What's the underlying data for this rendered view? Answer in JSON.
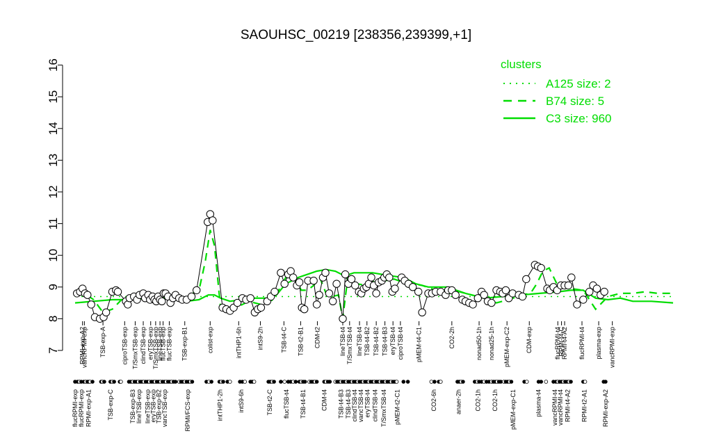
{
  "chart_data": {
    "type": "line",
    "title": "SAOUHSC_00219 [238356,239399,+1]",
    "xlabel": "",
    "ylabel": "",
    "ylim": [
      7,
      16
    ],
    "yticks": [
      7,
      8,
      9,
      10,
      11,
      12,
      13,
      14,
      15,
      16
    ],
    "x_range": [
      0,
      965
    ],
    "top_labels": [
      {
        "x": 12,
        "label": "RPMI-exp-A2"
      },
      {
        "x": 15,
        "label": "vancRPMI-exp"
      },
      {
        "x": 45,
        "label": "TSB-exp-A"
      },
      {
        "x": 80,
        "label": "ciproTSB-exp"
      },
      {
        "x": 97,
        "label": "T/SmxTSB-exp"
      },
      {
        "x": 110,
        "label": "clindTSB-exp"
      },
      {
        "x": 122,
        "label": "eryTSB-exp"
      },
      {
        "x": 130,
        "label": "T/SmxTSB-exp"
      },
      {
        "x": 137,
        "label": "lineTSB-exp"
      },
      {
        "x": 142,
        "label": "flucTSB-exp"
      },
      {
        "x": 152,
        "label": "flucTSB-exp"
      },
      {
        "x": 177,
        "label": "TSB-exp-B1"
      },
      {
        "x": 218,
        "label": "colist-exp"
      },
      {
        "x": 264,
        "label": "intTHP1-6h"
      },
      {
        "x": 299,
        "label": "intS9-2h"
      },
      {
        "x": 337,
        "label": "TSB-t4-C"
      },
      {
        "x": 364,
        "label": "TSB-t2-B1"
      },
      {
        "x": 391,
        "label": "CDM-t2"
      },
      {
        "x": 432,
        "label": "lineTSB-t4"
      },
      {
        "x": 443,
        "label": "T/SmxTSB-t4"
      },
      {
        "x": 459,
        "label": "lineTSB-t4"
      },
      {
        "x": 471,
        "label": "TSB-t4-B2"
      },
      {
        "x": 486,
        "label": "TSB-t4-B2"
      },
      {
        "x": 500,
        "label": "TSB-t4-B3"
      },
      {
        "x": 513,
        "label": "eryTSB-t4"
      },
      {
        "x": 525,
        "label": "ciproTSB-t4"
      },
      {
        "x": 555,
        "label": "pMEM-t4-C1"
      },
      {
        "x": 608,
        "label": "CO2-2h"
      },
      {
        "x": 652,
        "label": "nonad50-1h"
      },
      {
        "x": 672,
        "label": "nonad25-1h"
      },
      {
        "x": 697,
        "label": "pMEM-exp-C2"
      },
      {
        "x": 733,
        "label": "CDM-exp"
      },
      {
        "x": 779,
        "label": "flucRPMI-t4"
      },
      {
        "x": 785,
        "label": "RPMI-t4-C"
      },
      {
        "x": 790,
        "label": "RPMI-t4-A2"
      },
      {
        "x": 818,
        "label": "flucRPMI-t4"
      },
      {
        "x": 845,
        "label": "plasma-exp"
      },
      {
        "x": 867,
        "label": "vancRPMI-exp"
      }
    ],
    "bottom_labels": [
      {
        "x": 0,
        "label": "flucRPMI-exp"
      },
      {
        "x": 10,
        "label": "flucRPMI-exp"
      },
      {
        "x": 22,
        "label": "RPMI-exp-A1"
      },
      {
        "x": 57,
        "label": "TSB-exp-C"
      },
      {
        "x": 93,
        "label": "TSB-exp-B3"
      },
      {
        "x": 103,
        "label": "lineTSB-exp"
      },
      {
        "x": 117,
        "label": "lineTSB-exp"
      },
      {
        "x": 126,
        "label": "eryTSB-exp"
      },
      {
        "x": 135,
        "label": "TSB-exp-B2"
      },
      {
        "x": 145,
        "label": "vancTSB-exp"
      },
      {
        "x": 182,
        "label": "RPMI/FCS-exp"
      },
      {
        "x": 234,
        "label": "intTHP1-2h"
      },
      {
        "x": 268,
        "label": "intS9-6h"
      },
      {
        "x": 314,
        "label": "TSB-t2-C"
      },
      {
        "x": 341,
        "label": "flucTSB-t4"
      },
      {
        "x": 368,
        "label": "TSB-t4-B1"
      },
      {
        "x": 402,
        "label": "CDM-t4"
      },
      {
        "x": 429,
        "label": "TSB-t4-B3"
      },
      {
        "x": 441,
        "label": "TSB-t4-B3"
      },
      {
        "x": 451,
        "label": "clindTSB-t4"
      },
      {
        "x": 461,
        "label": "vancTSB-t4"
      },
      {
        "x": 472,
        "label": "eryTSB-t4"
      },
      {
        "x": 484,
        "label": "clindTSB-t4"
      },
      {
        "x": 498,
        "label": "T/SmxTSB-t4"
      },
      {
        "x": 520,
        "label": "pMEM-t2-C1"
      },
      {
        "x": 579,
        "label": "CO2-6h"
      },
      {
        "x": 619,
        "label": "anaer-2h"
      },
      {
        "x": 650,
        "label": "CO2-1h"
      },
      {
        "x": 678,
        "label": "CO2-1h"
      },
      {
        "x": 707,
        "label": "pMEM-exp-C1"
      },
      {
        "x": 748,
        "label": "plasma-t4"
      },
      {
        "x": 774,
        "label": "vancRPMI-t4"
      },
      {
        "x": 783,
        "label": "vancRPMI-t4"
      },
      {
        "x": 795,
        "label": "RPMI-t4-A2"
      },
      {
        "x": 822,
        "label": "RPMI-t2-A1"
      },
      {
        "x": 856,
        "label": "RPMI-exp-A2"
      }
    ],
    "series": [
      {
        "name": "A125 size: 2",
        "style": "dotted",
        "x": [
          0,
          965
        ],
        "y": [
          8.7,
          8.7
        ]
      },
      {
        "name": "B74 size: 5",
        "style": "dashed",
        "x": [
          0,
          15,
          30,
          45,
          60,
          75,
          95,
          110,
          125,
          140,
          155,
          170,
          185,
          200,
          210,
          218,
          225,
          235,
          250,
          265,
          280,
          300,
          320,
          340,
          355,
          365,
          375,
          385,
          395,
          405,
          415,
          425,
          432,
          440,
          455,
          470,
          485,
          500,
          515,
          530,
          545,
          560,
          575,
          590,
          605,
          620,
          640,
          660,
          680,
          700,
          720,
          735,
          745,
          755,
          765,
          780,
          800,
          820,
          840,
          860,
          880,
          900,
          920,
          940,
          965
        ],
        "y": [
          8.75,
          8.8,
          8.6,
          8.2,
          8.3,
          8.6,
          8.7,
          8.75,
          8.65,
          8.6,
          8.7,
          8.6,
          8.75,
          8.9,
          9.8,
          10.8,
          10.3,
          8.3,
          8.3,
          8.4,
          8.55,
          8.45,
          8.6,
          9.3,
          9.25,
          8.9,
          8.9,
          9.05,
          9.3,
          8.8,
          8.7,
          8.75,
          8.0,
          9.3,
          9.1,
          9.05,
          9.2,
          9.2,
          9.25,
          9.15,
          9.1,
          9.05,
          8.95,
          8.85,
          8.8,
          8.85,
          8.75,
          8.65,
          8.5,
          8.6,
          8.75,
          8.8,
          9.1,
          9.5,
          9.6,
          9.0,
          8.95,
          8.9,
          8.3,
          8.7,
          8.8,
          8.8,
          8.85,
          8.8,
          8.8
        ]
      },
      {
        "name": "C3 size: 960",
        "style": "solid",
        "x": [
          0,
          30,
          60,
          90,
          120,
          150,
          180,
          200,
          215,
          225,
          235,
          250,
          270,
          290,
          310,
          325,
          340,
          360,
          375,
          390,
          405,
          420,
          435,
          450,
          465,
          480,
          495,
          510,
          530,
          550,
          570,
          600,
          630,
          660,
          690,
          720,
          750,
          780,
          800,
          820,
          840,
          860,
          880,
          900,
          930,
          965
        ],
        "y": [
          8.5,
          8.55,
          8.6,
          8.6,
          8.65,
          8.65,
          8.55,
          8.6,
          8.75,
          8.75,
          8.65,
          8.55,
          8.6,
          8.65,
          8.65,
          8.75,
          9.1,
          9.3,
          9.4,
          9.5,
          9.55,
          9.5,
          9.35,
          9.45,
          9.45,
          9.45,
          9.4,
          9.35,
          9.3,
          9.1,
          9.0,
          9.0,
          8.8,
          8.65,
          8.7,
          8.75,
          8.8,
          8.85,
          8.9,
          8.9,
          8.65,
          8.6,
          8.65,
          8.55,
          8.55,
          8.5
        ]
      }
    ],
    "points": [
      {
        "x": 3,
        "y": 8.8
      },
      {
        "x": 8,
        "y": 8.85
      },
      {
        "x": 12,
        "y": 8.95
      },
      {
        "x": 16,
        "y": 8.8
      },
      {
        "x": 20,
        "y": 8.75
      },
      {
        "x": 26,
        "y": 8.45
      },
      {
        "x": 32,
        "y": 8.05
      },
      {
        "x": 40,
        "y": 8.0
      },
      {
        "x": 46,
        "y": 8.05
      },
      {
        "x": 50,
        "y": 8.2
      },
      {
        "x": 60,
        "y": 8.85
      },
      {
        "x": 66,
        "y": 8.9
      },
      {
        "x": 69,
        "y": 8.85
      },
      {
        "x": 82,
        "y": 8.55
      },
      {
        "x": 85,
        "y": 8.45
      },
      {
        "x": 88,
        "y": 8.65
      },
      {
        "x": 95,
        "y": 8.7
      },
      {
        "x": 100,
        "y": 8.6
      },
      {
        "x": 104,
        "y": 8.75
      },
      {
        "x": 110,
        "y": 8.8
      },
      {
        "x": 113,
        "y": 8.65
      },
      {
        "x": 118,
        "y": 8.75
      },
      {
        "x": 121,
        "y": 8.6
      },
      {
        "x": 125,
        "y": 8.7
      },
      {
        "x": 128,
        "y": 8.6
      },
      {
        "x": 131,
        "y": 8.55
      },
      {
        "x": 134,
        "y": 8.7
      },
      {
        "x": 137,
        "y": 8.6
      },
      {
        "x": 140,
        "y": 8.55
      },
      {
        "x": 143,
        "y": 8.8
      },
      {
        "x": 146,
        "y": 8.8
      },
      {
        "x": 150,
        "y": 8.7
      },
      {
        "x": 154,
        "y": 8.5
      },
      {
        "x": 158,
        "y": 8.65
      },
      {
        "x": 162,
        "y": 8.75
      },
      {
        "x": 168,
        "y": 8.65
      },
      {
        "x": 173,
        "y": 8.6
      },
      {
        "x": 180,
        "y": 8.6
      },
      {
        "x": 188,
        "y": 8.7
      },
      {
        "x": 196,
        "y": 8.9
      },
      {
        "x": 214,
        "y": 11.05
      },
      {
        "x": 218,
        "y": 11.3
      },
      {
        "x": 222,
        "y": 11.1
      },
      {
        "x": 238,
        "y": 8.35
      },
      {
        "x": 244,
        "y": 8.3
      },
      {
        "x": 250,
        "y": 8.25
      },
      {
        "x": 256,
        "y": 8.35
      },
      {
        "x": 262,
        "y": 8.5
      },
      {
        "x": 270,
        "y": 8.65
      },
      {
        "x": 276,
        "y": 8.6
      },
      {
        "x": 283,
        "y": 8.65
      },
      {
        "x": 290,
        "y": 8.2
      },
      {
        "x": 295,
        "y": 8.3
      },
      {
        "x": 300,
        "y": 8.35
      },
      {
        "x": 310,
        "y": 8.55
      },
      {
        "x": 316,
        "y": 8.7
      },
      {
        "x": 322,
        "y": 8.85
      },
      {
        "x": 332,
        "y": 9.45
      },
      {
        "x": 338,
        "y": 9.1
      },
      {
        "x": 344,
        "y": 9.4
      },
      {
        "x": 348,
        "y": 9.5
      },
      {
        "x": 352,
        "y": 9.3
      },
      {
        "x": 358,
        "y": 9.05
      },
      {
        "x": 362,
        "y": 9.15
      },
      {
        "x": 366,
        "y": 8.35
      },
      {
        "x": 370,
        "y": 8.3
      },
      {
        "x": 376,
        "y": 9.2
      },
      {
        "x": 385,
        "y": 9.2
      },
      {
        "x": 390,
        "y": 8.45
      },
      {
        "x": 394,
        "y": 8.75
      },
      {
        "x": 400,
        "y": 9.3
      },
      {
        "x": 404,
        "y": 9.45
      },
      {
        "x": 410,
        "y": 8.8
      },
      {
        "x": 416,
        "y": 8.55
      },
      {
        "x": 422,
        "y": 9.1
      },
      {
        "x": 432,
        "y": 8.0
      },
      {
        "x": 436,
        "y": 9.4
      },
      {
        "x": 441,
        "y": 9.1
      },
      {
        "x": 446,
        "y": 9.25
      },
      {
        "x": 452,
        "y": 9.05
      },
      {
        "x": 458,
        "y": 8.85
      },
      {
        "x": 462,
        "y": 8.8
      },
      {
        "x": 466,
        "y": 8.95
      },
      {
        "x": 470,
        "y": 9.0
      },
      {
        "x": 474,
        "y": 9.1
      },
      {
        "x": 478,
        "y": 9.3
      },
      {
        "x": 482,
        "y": 9.05
      },
      {
        "x": 486,
        "y": 8.8
      },
      {
        "x": 490,
        "y": 9.15
      },
      {
        "x": 495,
        "y": 9.2
      },
      {
        "x": 499,
        "y": 9.3
      },
      {
        "x": 503,
        "y": 9.4
      },
      {
        "x": 507,
        "y": 9.3
      },
      {
        "x": 512,
        "y": 8.85
      },
      {
        "x": 516,
        "y": 8.95
      },
      {
        "x": 527,
        "y": 9.3
      },
      {
        "x": 532,
        "y": 9.2
      },
      {
        "x": 538,
        "y": 9.1
      },
      {
        "x": 545,
        "y": 9.0
      },
      {
        "x": 554,
        "y": 8.85
      },
      {
        "x": 560,
        "y": 8.2
      },
      {
        "x": 570,
        "y": 8.8
      },
      {
        "x": 576,
        "y": 8.8
      },
      {
        "x": 582,
        "y": 8.85
      },
      {
        "x": 590,
        "y": 8.85
      },
      {
        "x": 598,
        "y": 8.75
      },
      {
        "x": 602,
        "y": 8.9
      },
      {
        "x": 608,
        "y": 8.9
      },
      {
        "x": 614,
        "y": 8.75
      },
      {
        "x": 625,
        "y": 8.6
      },
      {
        "x": 630,
        "y": 8.55
      },
      {
        "x": 636,
        "y": 8.5
      },
      {
        "x": 642,
        "y": 8.45
      },
      {
        "x": 650,
        "y": 8.65
      },
      {
        "x": 656,
        "y": 8.85
      },
      {
        "x": 660,
        "y": 8.75
      },
      {
        "x": 666,
        "y": 8.55
      },
      {
        "x": 672,
        "y": 8.5
      },
      {
        "x": 680,
        "y": 8.9
      },
      {
        "x": 686,
        "y": 8.85
      },
      {
        "x": 690,
        "y": 8.8
      },
      {
        "x": 695,
        "y": 8.9
      },
      {
        "x": 700,
        "y": 8.65
      },
      {
        "x": 706,
        "y": 8.8
      },
      {
        "x": 716,
        "y": 8.75
      },
      {
        "x": 722,
        "y": 8.7
      },
      {
        "x": 728,
        "y": 9.25
      },
      {
        "x": 742,
        "y": 9.7
      },
      {
        "x": 747,
        "y": 9.65
      },
      {
        "x": 752,
        "y": 9.6
      },
      {
        "x": 762,
        "y": 8.95
      },
      {
        "x": 766,
        "y": 8.9
      },
      {
        "x": 772,
        "y": 9.0
      },
      {
        "x": 778,
        "y": 8.9
      },
      {
        "x": 784,
        "y": 9.05
      },
      {
        "x": 790,
        "y": 9.05
      },
      {
        "x": 796,
        "y": 9.05
      },
      {
        "x": 801,
        "y": 9.3
      },
      {
        "x": 810,
        "y": 8.45
      },
      {
        "x": 820,
        "y": 8.6
      },
      {
        "x": 830,
        "y": 8.85
      },
      {
        "x": 836,
        "y": 9.05
      },
      {
        "x": 842,
        "y": 8.95
      },
      {
        "x": 848,
        "y": 8.75
      },
      {
        "x": 854,
        "y": 8.85
      }
    ],
    "bottom_marker_x": [
      0,
      4,
      7,
      10,
      14,
      17,
      20,
      22,
      24,
      28,
      42,
      44,
      47,
      57,
      60,
      63,
      72,
      74,
      87,
      90,
      93,
      96,
      99,
      102,
      105,
      108,
      111,
      114,
      117,
      120,
      123,
      126,
      129,
      132,
      135,
      138,
      141,
      144,
      147,
      150,
      153,
      156,
      159,
      162,
      168,
      171,
      174,
      177,
      180,
      183,
      186,
      189,
      212,
      216,
      220,
      233,
      236,
      239,
      246,
      250,
      266,
      270,
      274,
      283,
      286,
      289,
      312,
      315,
      318,
      321,
      332,
      338,
      344,
      348,
      352,
      356,
      362,
      365,
      368,
      371,
      378,
      381,
      384,
      387,
      390,
      402,
      405,
      408,
      411,
      420,
      423,
      426,
      429,
      432,
      435,
      438,
      441,
      444,
      447,
      450,
      453,
      456,
      459,
      462,
      465,
      468,
      471,
      474,
      477,
      480,
      483,
      486,
      489,
      492,
      495,
      498,
      501,
      504,
      507,
      510,
      513,
      516,
      519,
      530,
      537,
      575,
      580,
      587,
      590,
      617,
      620,
      623,
      626,
      645,
      649,
      652,
      656,
      660,
      664,
      668,
      672,
      675,
      678,
      681,
      684,
      687,
      692,
      695,
      698,
      701,
      704,
      725,
      729,
      748,
      752,
      760,
      772,
      776,
      779,
      782,
      785,
      788,
      791,
      794,
      797,
      800,
      820,
      823,
      853,
      856
    ]
  },
  "legend": {
    "title": "clusters",
    "entries": [
      "A125 size: 2",
      "B74 size: 5",
      "C3 size: 960"
    ],
    "position": "top-right"
  },
  "colors": {
    "line": "#00dd00",
    "text": "#000000",
    "legend_text": "#00dd00"
  }
}
